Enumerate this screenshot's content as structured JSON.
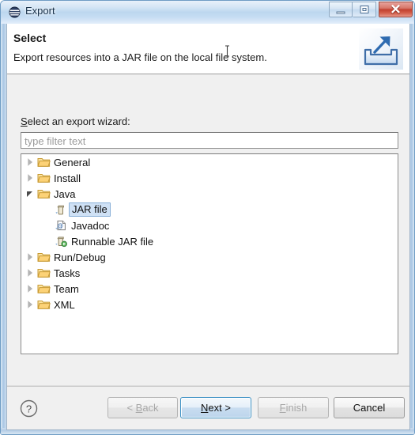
{
  "window": {
    "title": "Export",
    "icon": "eclipse-icon",
    "controls": {
      "minimize": "minimize-icon",
      "maximize": "restore-icon",
      "close": "close-icon"
    }
  },
  "header": {
    "title": "Select",
    "description": "Export resources into a JAR file on the local file system.",
    "icon": "export-banner-icon"
  },
  "body": {
    "wizard_label_prefix": "S",
    "wizard_label_rest": "elect an export wizard:",
    "filter": {
      "placeholder": "type filter text",
      "value": ""
    }
  },
  "tree": {
    "items": [
      {
        "label": "General",
        "level": 0,
        "state": "collapsed",
        "icon": "folder-icon",
        "selected": false
      },
      {
        "label": "Install",
        "level": 0,
        "state": "collapsed",
        "icon": "folder-icon",
        "selected": false
      },
      {
        "label": "Java",
        "level": 0,
        "state": "expanded",
        "icon": "folder-icon",
        "selected": false
      },
      {
        "label": "JAR file",
        "level": 1,
        "state": "leaf",
        "icon": "jar-file-icon",
        "selected": true
      },
      {
        "label": "Javadoc",
        "level": 1,
        "state": "leaf",
        "icon": "javadoc-icon",
        "selected": false
      },
      {
        "label": "Runnable JAR file",
        "level": 1,
        "state": "leaf",
        "icon": "runnable-jar-file-icon",
        "selected": false
      },
      {
        "label": "Run/Debug",
        "level": 0,
        "state": "collapsed",
        "icon": "folder-icon",
        "selected": false
      },
      {
        "label": "Tasks",
        "level": 0,
        "state": "collapsed",
        "icon": "folder-icon",
        "selected": false
      },
      {
        "label": "Team",
        "level": 0,
        "state": "collapsed",
        "icon": "folder-icon",
        "selected": false
      },
      {
        "label": "XML",
        "level": 0,
        "state": "collapsed",
        "icon": "folder-icon",
        "selected": false
      }
    ]
  },
  "buttons": {
    "help": "help-icon",
    "back": {
      "prefix": "< ",
      "mnemonic": "B",
      "suffix": "ack",
      "enabled": false,
      "default": false
    },
    "next": {
      "prefix": "",
      "mnemonic": "N",
      "suffix": "ext >",
      "enabled": true,
      "default": true
    },
    "finish": {
      "prefix": "",
      "mnemonic": "F",
      "suffix": "inish",
      "enabled": false,
      "default": false
    },
    "cancel": {
      "prefix": "",
      "mnemonic": "",
      "suffix": "Cancel",
      "enabled": true,
      "default": false
    }
  },
  "colors": {
    "titlebar": "#bcd7ef",
    "close_button": "#c2402f",
    "selection": "#cfe1f5",
    "selection_border": "#8ab0d8",
    "default_button_border": "#3c90c4",
    "folder": "#f2c14e",
    "dialog_background": "#f0f0f0"
  }
}
